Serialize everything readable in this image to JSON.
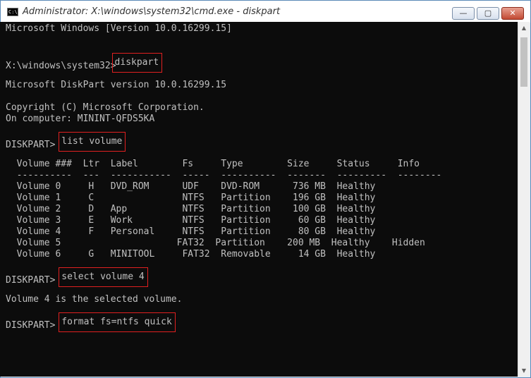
{
  "window": {
    "title": "Administrator: X:\\windows\\system32\\cmd.exe - diskpart",
    "icon": "C:\\.",
    "controls": {
      "minimize": "—",
      "maximize": "▢",
      "close": "✕"
    }
  },
  "console": {
    "version_line": "Microsoft Windows [Version 10.0.16299.15]",
    "prompt1": "X:\\windows\\system32>",
    "cmd1": "diskpart",
    "diskpart_version": "Microsoft DiskPart version 10.0.16299.15",
    "copyright": "Copyright (C) Microsoft Corporation.",
    "computer": "On computer: MININT-QFDS5KA",
    "prompt2": "DISKPART> ",
    "cmd2": "list volume",
    "table_header": "  Volume ###  Ltr  Label        Fs     Type        Size     Status     Info",
    "table_sep": "  ----------  ---  -----------  -----  ----------  -------  ---------  --------",
    "rows": [
      "  Volume 0     H   DVD_ROM      UDF    DVD-ROM      736 MB  Healthy",
      "  Volume 1     C                NTFS   Partition    196 GB  Healthy",
      "  Volume 2     D   App          NTFS   Partition    100 GB  Healthy",
      "  Volume 3     E   Work         NTFS   Partition     60 GB  Healthy",
      "  Volume 4     F   Personal     NTFS   Partition     80 GB  Healthy",
      "  Volume 5                     FAT32  Partition    200 MB  Healthy    Hidden",
      "  Volume 6     G   MINITOOL     FAT32  Removable     14 GB  Healthy"
    ],
    "prompt3": "DISKPART> ",
    "cmd3": "select volume 4",
    "selected_msg": "Volume 4 is the selected volume.",
    "prompt4": "DISKPART> ",
    "cmd4": "format fs=ntfs quick"
  },
  "scrollbar": {
    "up": "▲",
    "down": "▼"
  }
}
